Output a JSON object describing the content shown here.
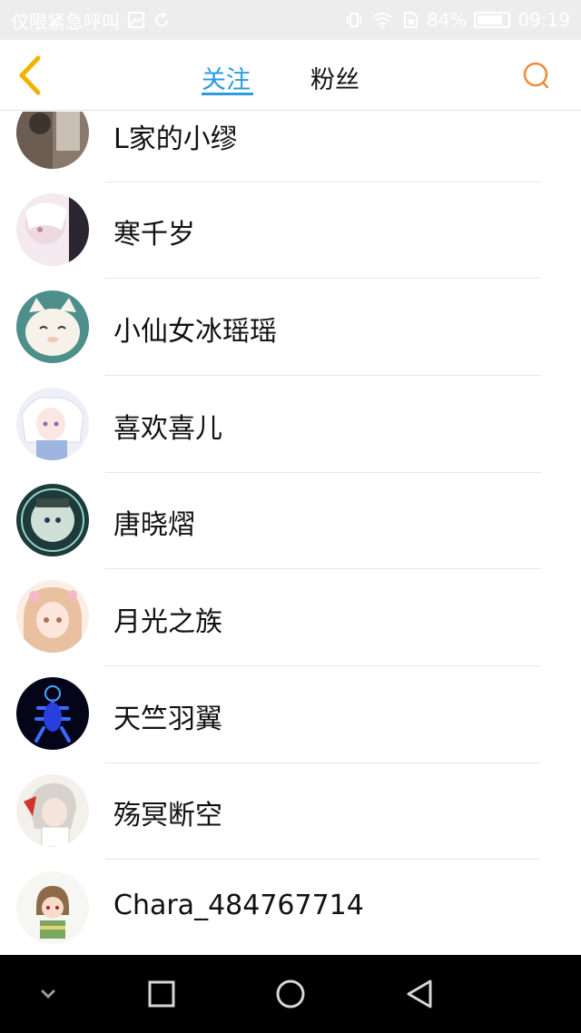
{
  "status_bar": {
    "carrier": "仅限紧急呼叫",
    "battery": "84%",
    "battery_level": 0.84,
    "time": "09:19",
    "icons": [
      "image-icon",
      "sync-icon",
      "vibrate-icon",
      "wifi-icon",
      "sim-icon",
      "battery-icon"
    ]
  },
  "header": {
    "back_icon": "chevron-left-icon",
    "tabs": [
      {
        "label": "关注",
        "active": true
      },
      {
        "label": "粉丝",
        "active": false
      }
    ],
    "search_icon": "search-icon",
    "accent": "#2a9be0",
    "back_color": "#f0b400",
    "search_color": "#ef8a3a"
  },
  "follow_list": [
    {
      "name": "L家的小缪"
    },
    {
      "name": "寒千岁"
    },
    {
      "name": "小仙女冰瑶瑶"
    },
    {
      "name": "喜欢喜儿"
    },
    {
      "name": "唐晓熠"
    },
    {
      "name": "月光之族"
    },
    {
      "name": "天竺羽翼"
    },
    {
      "name": "殇冥断空"
    },
    {
      "name": "Chara_484767714"
    }
  ],
  "nav_bar": {
    "icons": [
      "chevron-down-icon",
      "recent-apps-icon",
      "home-icon",
      "back-triangle-icon"
    ]
  }
}
